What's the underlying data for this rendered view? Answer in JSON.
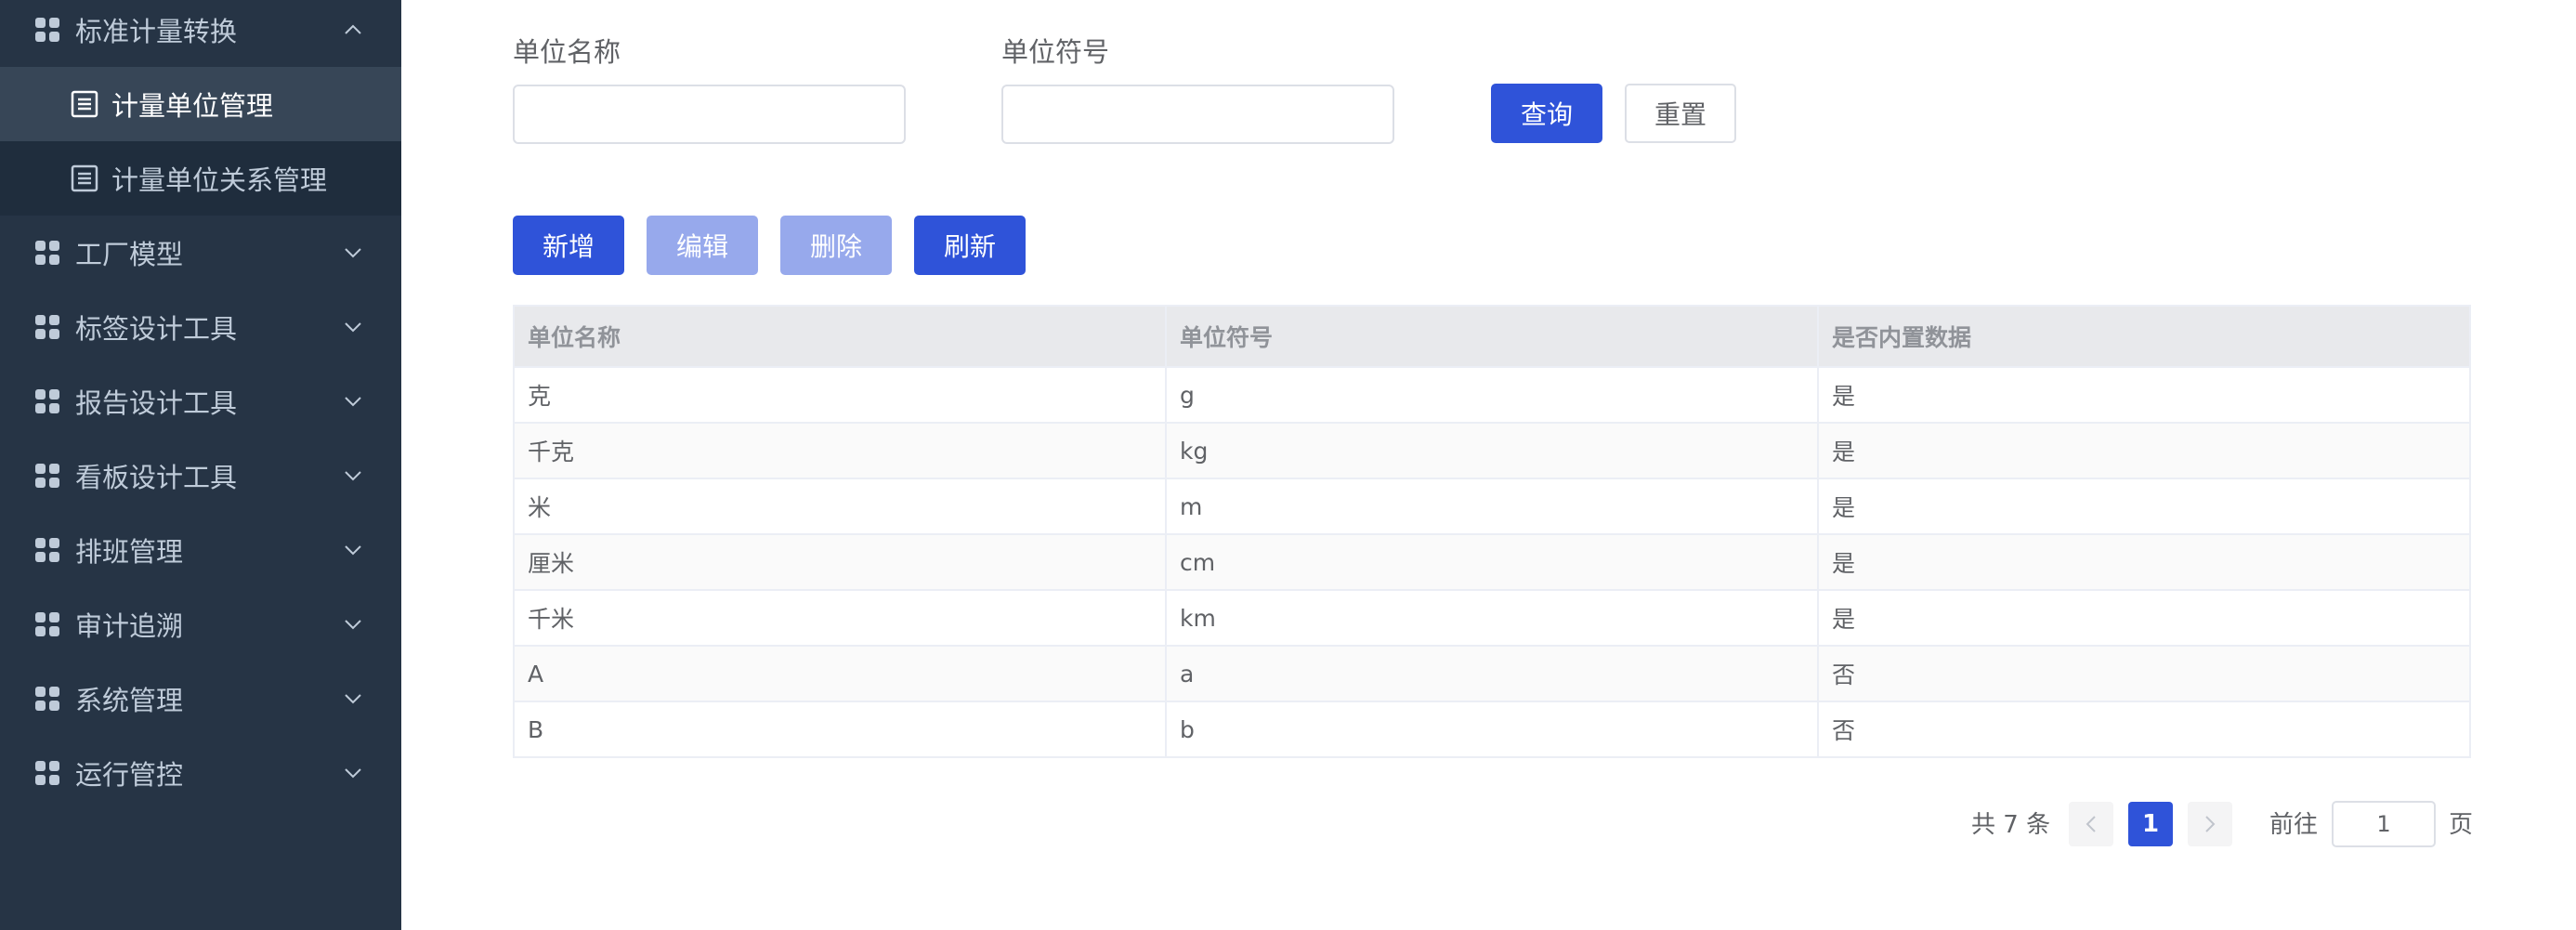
{
  "sidebar": {
    "items": [
      {
        "label": "标准计量转换",
        "type": "group",
        "expanded": true,
        "icon": "grid-icon"
      },
      {
        "label": "计量单位管理",
        "type": "sub",
        "active": true,
        "icon": "document-icon"
      },
      {
        "label": "计量单位关系管理",
        "type": "sub",
        "active": false,
        "icon": "document-icon"
      },
      {
        "label": "工厂模型",
        "type": "group",
        "expanded": false,
        "icon": "grid-icon"
      },
      {
        "label": "标签设计工具",
        "type": "group",
        "expanded": false,
        "icon": "grid-icon"
      },
      {
        "label": "报告设计工具",
        "type": "group",
        "expanded": false,
        "icon": "grid-icon"
      },
      {
        "label": "看板设计工具",
        "type": "group",
        "expanded": false,
        "icon": "grid-icon"
      },
      {
        "label": "排班管理",
        "type": "group",
        "expanded": false,
        "icon": "grid-icon"
      },
      {
        "label": "审计追溯",
        "type": "group",
        "expanded": false,
        "icon": "grid-icon"
      },
      {
        "label": "系统管理",
        "type": "group",
        "expanded": false,
        "icon": "grid-icon"
      },
      {
        "label": "运行管控",
        "type": "group",
        "expanded": false,
        "icon": "grid-icon"
      }
    ]
  },
  "search": {
    "unit_name_label": "单位名称",
    "unit_name_value": "",
    "unit_symbol_label": "单位符号",
    "unit_symbol_value": "",
    "query_label": "查询",
    "reset_label": "重置"
  },
  "toolbar": {
    "add_label": "新增",
    "edit_label": "编辑",
    "delete_label": "删除",
    "refresh_label": "刷新"
  },
  "table": {
    "headers": [
      "单位名称",
      "单位符号",
      "是否内置数据"
    ],
    "rows": [
      [
        "克",
        "g",
        "是"
      ],
      [
        "千克",
        "kg",
        "是"
      ],
      [
        "米",
        "m",
        "是"
      ],
      [
        "厘米",
        "cm",
        "是"
      ],
      [
        "千米",
        "km",
        "是"
      ],
      [
        "A",
        "a",
        "否"
      ],
      [
        "B",
        "b",
        "否"
      ]
    ]
  },
  "pagination": {
    "total_text": "共 7 条",
    "current_page": "1",
    "goto_prefix": "前往",
    "goto_value": "1",
    "goto_suffix": "页"
  },
  "colors": {
    "sidebar_bg": "#263445",
    "submenu_bg": "#1f2d3d",
    "active_bg": "#374657",
    "primary": "#2f53d9",
    "primary_disabled": "#97a9ec"
  }
}
